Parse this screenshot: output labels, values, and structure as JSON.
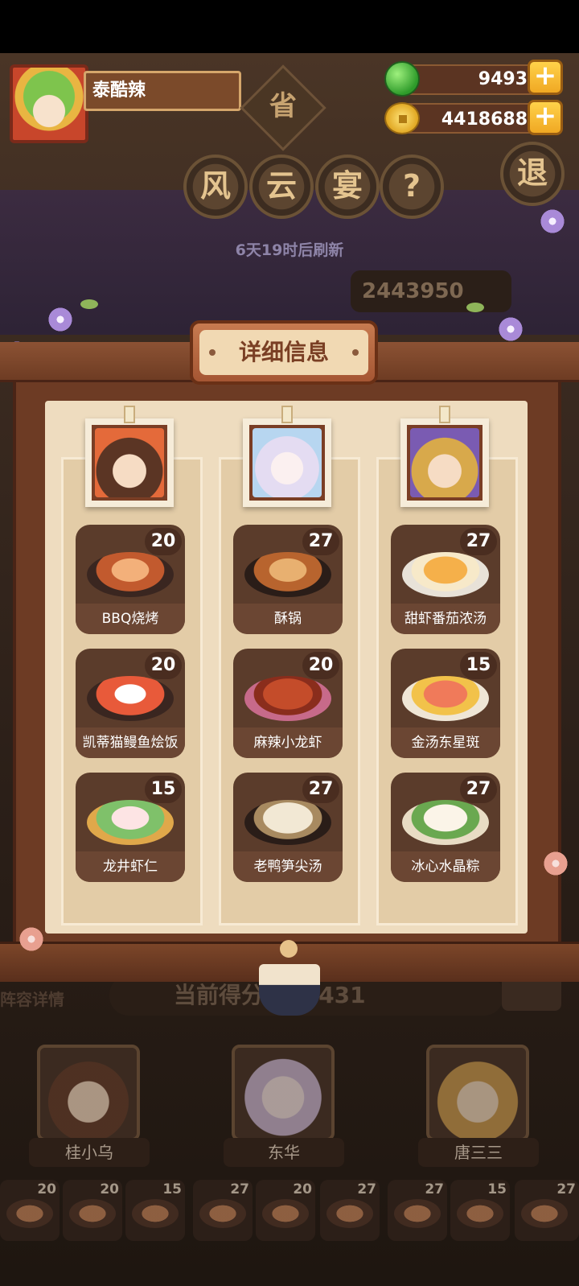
{
  "player": {
    "name": "泰酷辣"
  },
  "resources": {
    "apples": "9493",
    "coins": "4418688"
  },
  "title_chars": [
    "风",
    "云",
    "宴"
  ],
  "help_symbol": "?",
  "province_badge": "省",
  "back_label": "退",
  "refresh_text": "6天19时后刷新",
  "background_score": "2443950",
  "detail_title": "详细信息",
  "current_score_text": "当前得分 237431",
  "lineup_text": "阵容详情",
  "columns": [
    {
      "dishes": [
        {
          "name": "BBQ烧烤",
          "count": "20"
        },
        {
          "name": "凯蒂猫鳗鱼烩饭",
          "count": "20"
        },
        {
          "name": "龙井虾仁",
          "count": "15"
        }
      ]
    },
    {
      "dishes": [
        {
          "name": "酥锅",
          "count": "27"
        },
        {
          "name": "麻辣小龙虾",
          "count": "20"
        },
        {
          "name": "老鸭笋尖汤",
          "count": "27"
        }
      ]
    },
    {
      "dishes": [
        {
          "name": "甜虾番茄浓汤",
          "count": "27"
        },
        {
          "name": "金汤东星斑",
          "count": "15"
        },
        {
          "name": "冰心水晶粽",
          "count": "27"
        }
      ]
    }
  ],
  "chefs": [
    {
      "name": "桂小乌"
    },
    {
      "name": "东华"
    },
    {
      "name": "唐三三"
    }
  ],
  "bottom_dish_counts": [
    "20",
    "20",
    "15",
    "27",
    "20",
    "27",
    "27",
    "15",
    "27"
  ],
  "colors": {
    "accent": "#f0a823",
    "panel_wood": "#6d3b24",
    "parchment": "#eedcbf"
  }
}
